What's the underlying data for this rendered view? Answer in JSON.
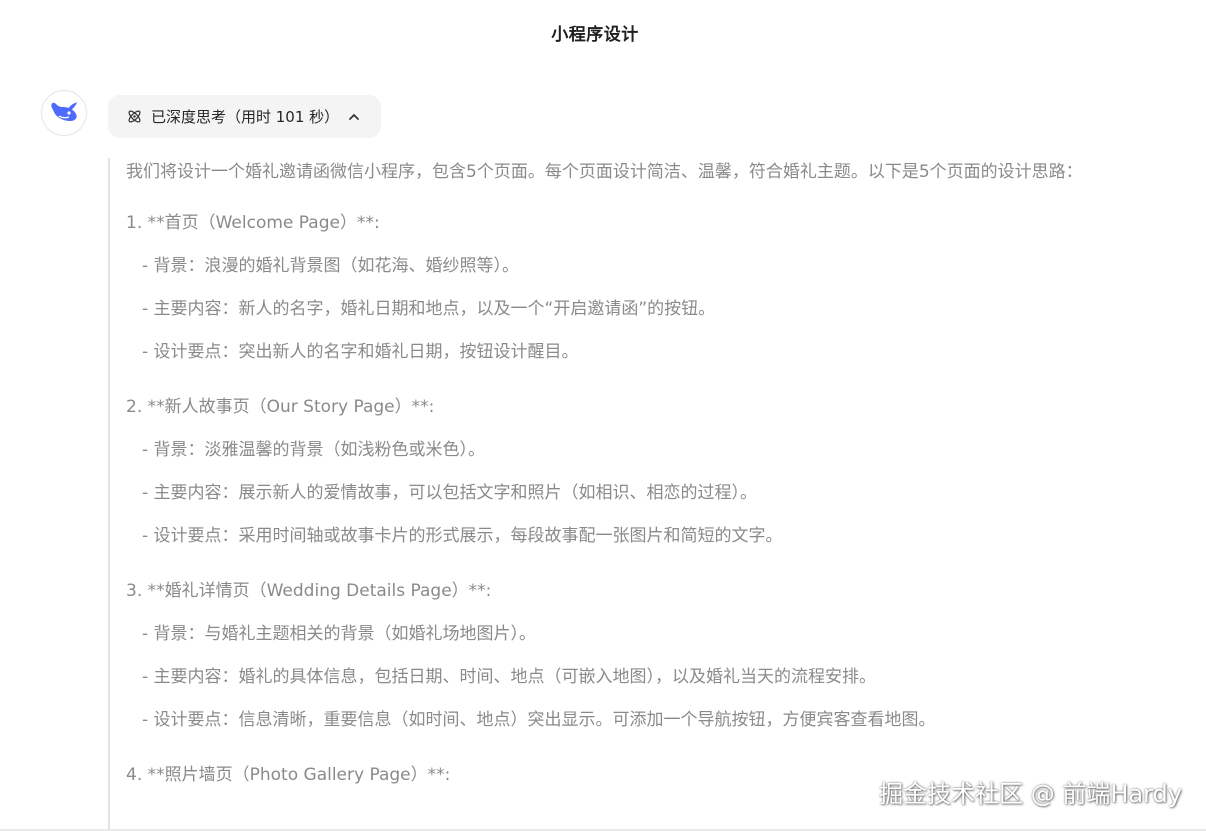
{
  "header": {
    "title": "小程序设计"
  },
  "assistant": {
    "avatar_icon": "whale-logo-icon",
    "brand_color": "#4d6bfe"
  },
  "thinking": {
    "label": "已深度思考（用时 101 秒）",
    "icon": "atom-icon",
    "chevron": "chevron-up-icon"
  },
  "reasoning": {
    "intro": "我们将设计一个婚礼邀请函微信小程序，包含5个页面。每个页面设计简洁、温馨，符合婚礼主题。以下是5个页面的设计思路：",
    "sections": [
      {
        "title": "1. **首页（Welcome Page）**:",
        "bullets": [
          "- 背景：浪漫的婚礼背景图（如花海、婚纱照等）。",
          "- 主要内容：新人的名字，婚礼日期和地点，以及一个“开启邀请函”的按钮。",
          "- 设计要点：突出新人的名字和婚礼日期，按钮设计醒目。"
        ]
      },
      {
        "title": "2. **新人故事页（Our Story Page）**:",
        "bullets": [
          "- 背景：淡雅温馨的背景（如浅粉色或米色）。",
          "- 主要内容：展示新人的爱情故事，可以包括文字和照片（如相识、相恋的过程）。",
          "- 设计要点：采用时间轴或故事卡片的形式展示，每段故事配一张图片和简短的文字。"
        ]
      },
      {
        "title": "3. **婚礼详情页（Wedding Details Page）**:",
        "bullets": [
          "- 背景：与婚礼主题相关的背景（如婚礼场地图片）。",
          "- 主要内容：婚礼的具体信息，包括日期、时间、地点（可嵌入地图），以及婚礼当天的流程安排。",
          "- 设计要点：信息清晰，重要信息（如时间、地点）突出显示。可添加一个导航按钮，方便宾客查看地图。"
        ]
      },
      {
        "title": "4. **照片墙页（Photo Gallery Page）**:",
        "bullets": []
      }
    ]
  },
  "watermark": "掘金技术社区 @ 前端Hardy"
}
